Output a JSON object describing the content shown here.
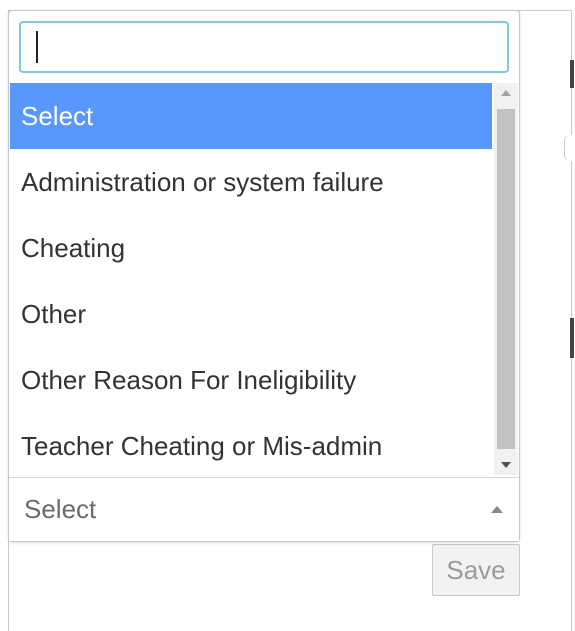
{
  "search": {
    "value": "",
    "placeholder": ""
  },
  "options": [
    {
      "label": "Select",
      "selected": true
    },
    {
      "label": "Administration or system failure",
      "selected": false
    },
    {
      "label": "Cheating",
      "selected": false
    },
    {
      "label": "Other",
      "selected": false
    },
    {
      "label": "Other Reason For Ineligibility",
      "selected": false
    },
    {
      "label": "Teacher Cheating or Mis-admin",
      "selected": false
    }
  ],
  "select": {
    "current_value": "Select",
    "arrow_icon": "chevron-up-icon"
  },
  "scrollbar": {
    "up_icon": "scroll-up-arrow-icon",
    "down_icon": "scroll-down-arrow-icon"
  },
  "actions": {
    "save_label": "Save"
  },
  "colors": {
    "highlight": "#5897fb",
    "search_focus_border": "#7fc8de",
    "text": "#333333",
    "placeholder_text": "#6b6b6b"
  }
}
